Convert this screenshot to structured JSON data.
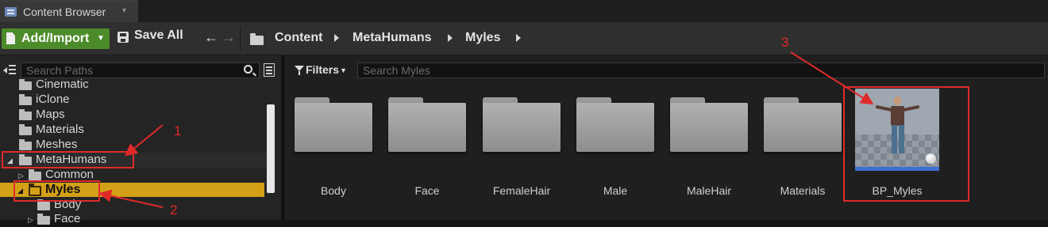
{
  "window": {
    "tab_title": "Content Browser"
  },
  "toolbar": {
    "add_import_label": "Add/Import",
    "save_all_label": "Save All",
    "breadcrumbs": [
      "Content",
      "MetaHumans",
      "Myles"
    ]
  },
  "sources": {
    "search_placeholder": "Search Paths",
    "tree": [
      {
        "label": "Cinematic",
        "depth": 1
      },
      {
        "label": "iClone",
        "depth": 1
      },
      {
        "label": "Maps",
        "depth": 1
      },
      {
        "label": "Materials",
        "depth": 1
      },
      {
        "label": "Meshes",
        "depth": 1
      },
      {
        "label": "MetaHumans",
        "depth": 0,
        "expanded": true
      },
      {
        "label": "Common",
        "depth": 1,
        "expanded": false
      },
      {
        "label": "Myles",
        "depth": 1,
        "expanded": true,
        "selected": true
      },
      {
        "label": "Body",
        "depth": 2
      },
      {
        "label": "Face",
        "depth": 2,
        "expanded": false
      }
    ]
  },
  "assets": {
    "filters_label": "Filters",
    "search_placeholder": "Search Myles",
    "folders": [
      "Body",
      "Face",
      "FemaleHair",
      "Male",
      "MaleHair",
      "Materials"
    ],
    "blueprint": "BP_Myles"
  },
  "annotations": [
    "1",
    "2",
    "3"
  ],
  "colors": {
    "selection": "#d4a017",
    "add_button": "#4c8b2a",
    "annotation": "#e02a2a"
  }
}
